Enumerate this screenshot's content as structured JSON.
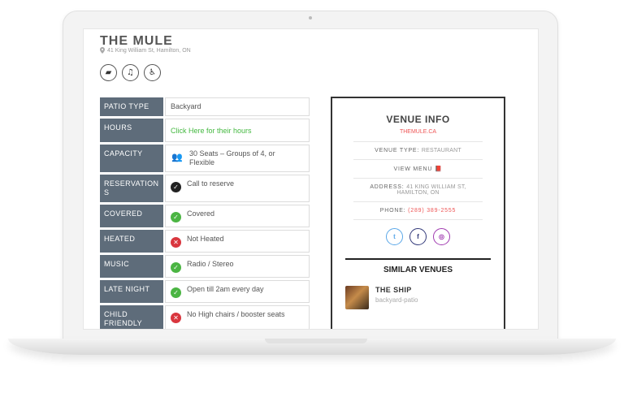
{
  "venue": {
    "title": "THE MULE",
    "address": "41 King William St, Hamilton, ON"
  },
  "amenities": [
    {
      "icon": "patio-icon",
      "glyph": "▰"
    },
    {
      "icon": "music-note-icon",
      "glyph": "♫"
    },
    {
      "icon": "wheelchair-icon",
      "glyph": "♿"
    }
  ],
  "details": [
    {
      "label": "PATIO TYPE",
      "value": "Backyard",
      "icon": ""
    },
    {
      "label": "HOURS",
      "value": "Click Here for their hours",
      "icon": ""
    },
    {
      "label": "CAPACITY",
      "value": "30 Seats – Groups of 4, or Flexible",
      "icon": "people-icon"
    },
    {
      "label": "RESERVATIONS",
      "value": "Call to reserve",
      "icon": "check-dark-icon"
    },
    {
      "label": "COVERED",
      "value": "Covered",
      "icon": "check-icon"
    },
    {
      "label": "HEATED",
      "value": "Not Heated",
      "icon": "cross-icon"
    },
    {
      "label": "MUSIC",
      "value": "Radio / Stereo",
      "icon": "check-icon"
    },
    {
      "label": "LATE NIGHT",
      "value": "Open till 2am every day",
      "icon": "check-icon"
    },
    {
      "label": "CHILD FRIENDLY",
      "value": "No High chairs / booster seats",
      "icon": "cross-icon"
    }
  ],
  "card": {
    "title": "VENUE INFO",
    "website": "THEMULE.CA",
    "venue_type_label": "VENUE TYPE:",
    "venue_type_value": "RESTAURANT",
    "view_menu": "VIEW MENU",
    "address_label": "ADDRESS:",
    "address_value": "41 KING WILLIAM ST, HAMILTON, ON",
    "phone_label": "PHONE:",
    "phone_value": "(289) 389-2555",
    "socials": [
      "twitter-icon",
      "facebook-icon",
      "instagram-icon"
    ],
    "similar_title": "SIMILAR VENUES",
    "similar": [
      {
        "name": "THE SHIP",
        "sub": "backyard-patio"
      }
    ]
  },
  "colors": {
    "label_bg": "#5e6c7a",
    "link_green": "#44b840",
    "accent_red": "#e55555"
  }
}
